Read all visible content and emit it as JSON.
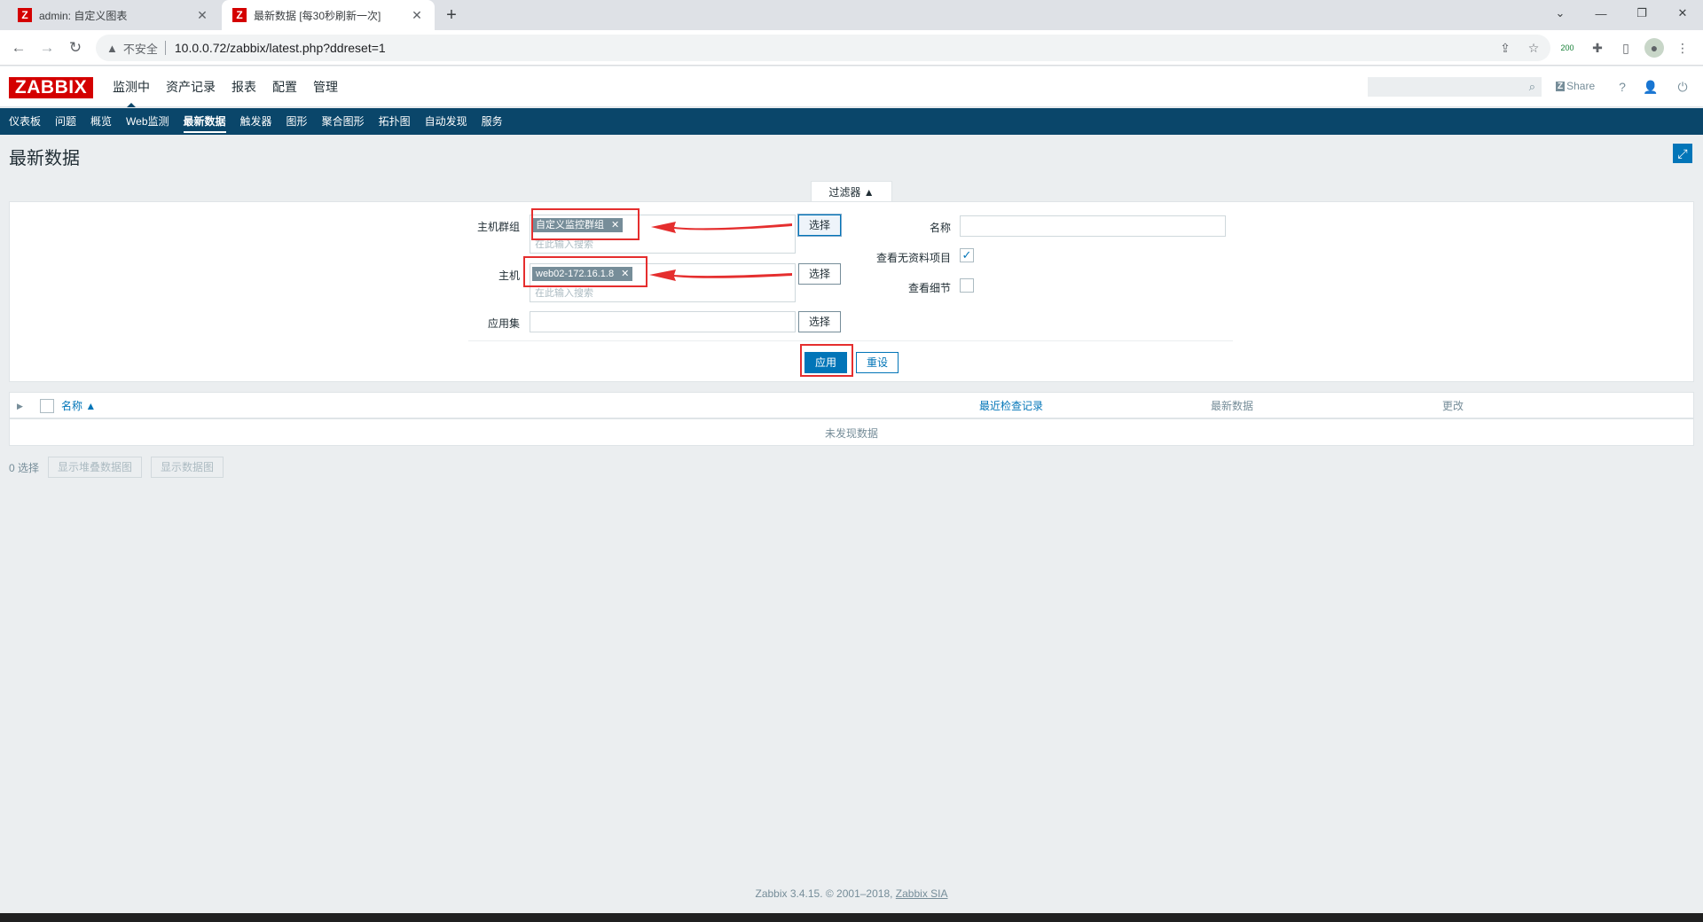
{
  "browser": {
    "tabs": [
      {
        "title": "admin: 自定义图表",
        "favicon": "Z",
        "active": false
      },
      {
        "title": "最新数据 [每30秒刷新一次]",
        "favicon": "Z",
        "active": true
      }
    ],
    "address": {
      "security_label": "不安全",
      "url": "10.0.0.72/zabbix/latest.php?ddreset=1"
    },
    "extension_badge": "200"
  },
  "header": {
    "logo": "ZABBIX",
    "menu": [
      {
        "label": "监测中",
        "selected": true
      },
      {
        "label": "资产记录"
      },
      {
        "label": "报表"
      },
      {
        "label": "配置"
      },
      {
        "label": "管理"
      }
    ],
    "share_label": "Share",
    "help_label": "?"
  },
  "submenu": [
    {
      "label": "仪表板"
    },
    {
      "label": "问题"
    },
    {
      "label": "概览"
    },
    {
      "label": "Web监测"
    },
    {
      "label": "最新数据",
      "selected": true
    },
    {
      "label": "触发器"
    },
    {
      "label": "图形"
    },
    {
      "label": "聚合图形"
    },
    {
      "label": "拓扑图"
    },
    {
      "label": "自动发现"
    },
    {
      "label": "服务"
    }
  ],
  "page": {
    "title": "最新数据"
  },
  "filter": {
    "tab_label": "过滤器 ▲",
    "host_group": {
      "label": "主机群组",
      "chip": "自定义监控群组",
      "placeholder": "在此输入搜索",
      "button": "选择"
    },
    "host": {
      "label": "主机",
      "chip": "web02-172.16.1.8",
      "placeholder": "在此输入搜索",
      "button": "选择"
    },
    "application": {
      "label": "应用集",
      "value": "",
      "button": "选择"
    },
    "name": {
      "label": "名称",
      "value": ""
    },
    "show_items_without_data": {
      "label": "查看无资料项目",
      "checked": true
    },
    "show_details": {
      "label": "查看细节",
      "checked": false
    },
    "apply_label": "应用",
    "reset_label": "重设"
  },
  "table": {
    "columns": {
      "name": "名称 ▲",
      "last_check": "最近检查记录",
      "last_value": "最新数据",
      "change": "更改"
    },
    "empty_message": "未发现数据"
  },
  "footer_actions": {
    "selected_count": "0 选择",
    "stacked_graph": "显示堆叠数据图",
    "graph": "显示数据图"
  },
  "copyright": {
    "text": "Zabbix 3.4.15. © 2001–2018, ",
    "link": "Zabbix SIA"
  },
  "colors": {
    "brand_red": "#d40000",
    "nav_blue": "#0a466a",
    "accent_blue": "#0275b8",
    "annotation_red": "#e52e2e"
  }
}
